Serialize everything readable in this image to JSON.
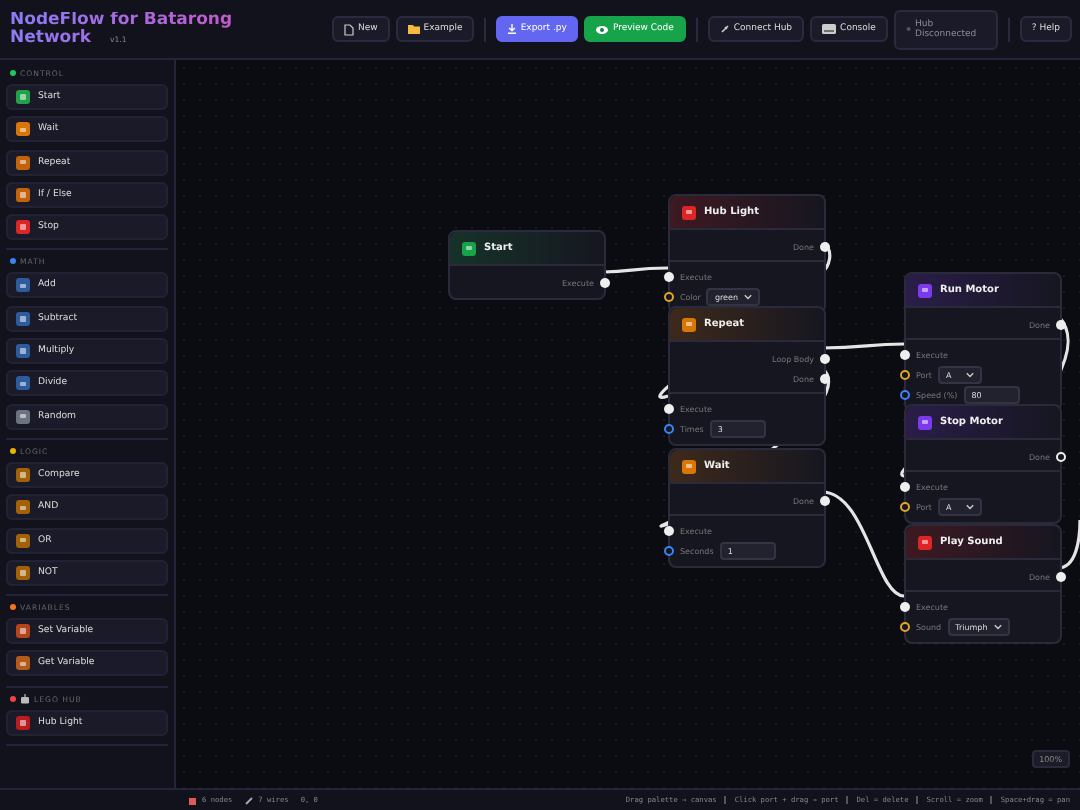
{
  "header": {
    "title": "NodeFlow for Batarong Network",
    "version": "v1.1",
    "buttons": [
      {
        "label": "New",
        "kind": "plain"
      },
      {
        "label": "Example",
        "kind": "plain"
      },
      {
        "label": "Export .py",
        "kind": "primary"
      },
      {
        "label": "Preview Code",
        "kind": "success"
      },
      {
        "label": "Connect Hub",
        "kind": "plain"
      },
      {
        "label": "Console",
        "kind": "plain"
      },
      {
        "label": "Hub Disconnected",
        "kind": "status"
      },
      {
        "label": "? Help",
        "kind": "plain"
      }
    ]
  },
  "sidebar": {
    "categories": [
      {
        "title": "CONTROL",
        "color": "#22c55e",
        "items": [
          {
            "label": "Start",
            "color": "#22a04a"
          },
          {
            "label": "Wait",
            "color": "#d97706"
          },
          {
            "label": "Repeat",
            "color": "#c2620a"
          },
          {
            "label": "If / Else",
            "color": "#c2620a"
          },
          {
            "label": "Stop",
            "color": "#dc2626"
          }
        ]
      },
      {
        "title": "MATH",
        "color": "#3b82f6",
        "items": [
          {
            "label": "Add",
            "color": "#2e5b9e"
          },
          {
            "label": "Subtract",
            "color": "#2e5b9e"
          },
          {
            "label": "Multiply",
            "color": "#2e5b9e"
          },
          {
            "label": "Divide",
            "color": "#2e5b9e"
          },
          {
            "label": "Random",
            "color": "#6b7280"
          }
        ]
      },
      {
        "title": "LOGIC",
        "color": "#eab308",
        "items": [
          {
            "label": "Compare",
            "color": "#a16207"
          },
          {
            "label": "AND",
            "color": "#a16207"
          },
          {
            "label": "OR",
            "color": "#a16207"
          },
          {
            "label": "NOT",
            "color": "#a16207"
          }
        ]
      },
      {
        "title": "VARIABLES",
        "color": "#f97316",
        "items": [
          {
            "label": "Set Variable",
            "color": "#b4441a"
          },
          {
            "label": "Get Variable",
            "color": "#b45a1a"
          }
        ]
      },
      {
        "title": "LEGO HUB",
        "color": "#ef4444",
        "items": [
          {
            "label": "Hub Light",
            "color": "#b91c1c"
          }
        ]
      }
    ]
  },
  "nodes": [
    {
      "title": "Start",
      "color": "#16a34a",
      "rows": [
        {
          "kind": "out",
          "label": "Execute",
          "connected": true
        }
      ]
    },
    {
      "title": "Hub Light",
      "color": "#dc2626",
      "rows": [
        {
          "kind": "out",
          "label": "Done",
          "connected": true
        },
        {
          "kind": "divider"
        },
        {
          "kind": "in",
          "label": "Execute"
        },
        {
          "kind": "select",
          "label": "Color",
          "value": "green"
        }
      ]
    },
    {
      "title": "Repeat",
      "color": "#d97706",
      "rows": [
        {
          "kind": "out",
          "label": "Loop Body",
          "connected": true
        },
        {
          "kind": "out",
          "label": "Done",
          "connected": true
        },
        {
          "kind": "divider"
        },
        {
          "kind": "in",
          "label": "Execute"
        },
        {
          "kind": "number",
          "label": "Times",
          "value": "3"
        }
      ]
    },
    {
      "title": "Wait",
      "color": "#d97706",
      "rows": [
        {
          "kind": "out",
          "label": "Done",
          "connected": true
        },
        {
          "kind": "divider"
        },
        {
          "kind": "in",
          "label": "Execute"
        },
        {
          "kind": "number",
          "label": "Seconds",
          "value": "1"
        }
      ]
    },
    {
      "title": "Run Motor",
      "color": "#7c3aed",
      "rows": [
        {
          "kind": "out",
          "label": "Done",
          "connected": true
        },
        {
          "kind": "divider"
        },
        {
          "kind": "in",
          "label": "Execute"
        },
        {
          "kind": "select",
          "label": "Port",
          "value": "A"
        },
        {
          "kind": "number",
          "label": "Speed (%)",
          "value": "80"
        }
      ]
    },
    {
      "title": "Stop Motor",
      "color": "#7c3aed",
      "rows": [
        {
          "kind": "out",
          "label": "Done",
          "connected": false
        },
        {
          "kind": "divider"
        },
        {
          "kind": "in",
          "label": "Execute"
        },
        {
          "kind": "select",
          "label": "Port",
          "value": "A"
        }
      ]
    },
    {
      "title": "Play Sound",
      "color": "#dc2626",
      "rows": [
        {
          "kind": "out",
          "label": "Done",
          "connected": true
        },
        {
          "kind": "divider"
        },
        {
          "kind": "in",
          "label": "Execute"
        },
        {
          "kind": "select",
          "label": "Sound",
          "value": "Triumph"
        }
      ]
    }
  ],
  "zoom": "100%",
  "status_bar": {
    "nodes": "6 nodes",
    "wires": "7 wires",
    "position": "0, 0",
    "hints": [
      "Drag palette → canvas",
      "Click port + drag → port",
      "Del = delete",
      "Scroll = zoom",
      "Space+drag = pan"
    ]
  }
}
